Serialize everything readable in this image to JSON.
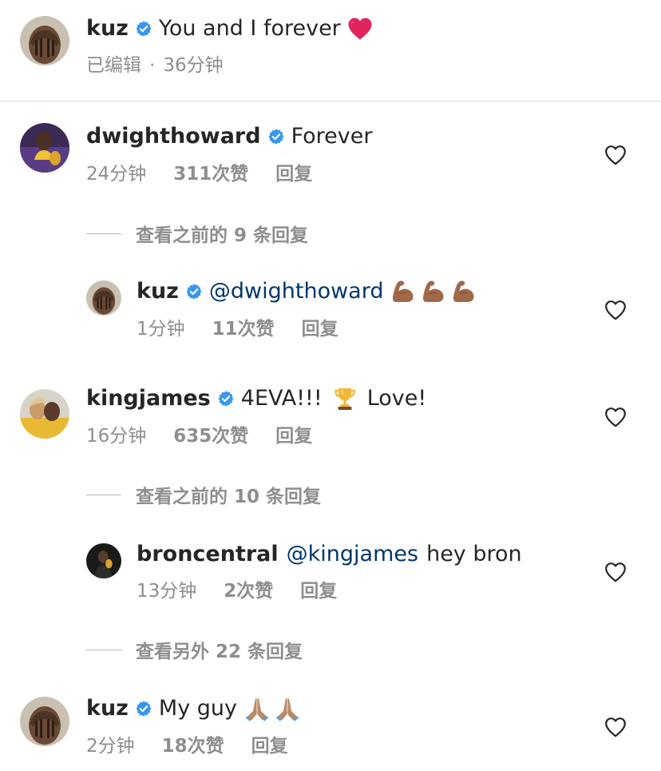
{
  "caption": {
    "username": "kuz",
    "text": "You and I forever",
    "edited": "已编辑",
    "dot": "·",
    "time": "36分钟"
  },
  "comments": [
    {
      "username": "dwighthoward",
      "text": "Forever",
      "time": "24分钟",
      "likes": "311次赞",
      "reply": "回复",
      "view_replies": "查看之前的 9 条回复",
      "replies": [
        {
          "username": "kuz",
          "mention": "@dwighthoward",
          "text": "",
          "time": "1分钟",
          "likes": "11次赞",
          "reply": "回复"
        }
      ]
    },
    {
      "username": "kingjames",
      "text": "4EVA!!!",
      "text2": "Love!",
      "time": "16分钟",
      "likes": "635次赞",
      "reply": "回复",
      "view_replies": "查看之前的 10 条回复",
      "replies": [
        {
          "username": "broncentral",
          "mention": "@kingjames",
          "text": "hey bron",
          "time": "13分钟",
          "likes": "2次赞",
          "reply": "回复"
        }
      ],
      "view_more": "查看另外 22 条回复"
    },
    {
      "username": "kuz",
      "text": "My guy",
      "time": "2分钟",
      "likes": "18次赞",
      "reply": "回复"
    }
  ],
  "colors": {
    "verified": "#3897f0",
    "mention": "#00376b",
    "meta": "#8e8e8e",
    "heart_emoji": "#e0245e"
  },
  "icons": {
    "verified": "verified-badge-icon",
    "heart_outline": "heart-outline-icon",
    "heart_emoji": "red-heart-emoji",
    "flexed_bicep": "flexed-bicep-emoji",
    "trophy": "trophy-emoji",
    "folded_hands": "folded-hands-emoji"
  }
}
